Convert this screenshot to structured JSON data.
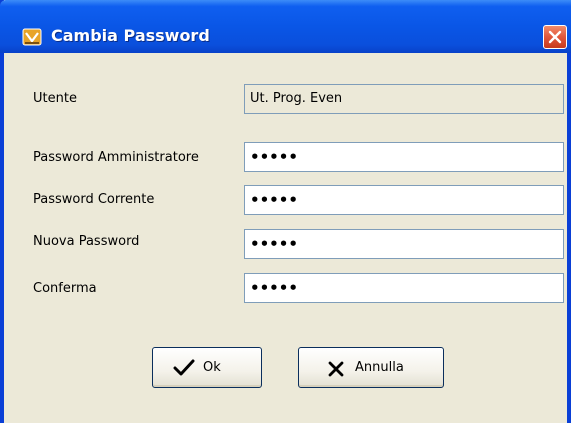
{
  "window": {
    "title": "Cambia Password"
  },
  "form": {
    "user_label": "Utente",
    "user_value": "Ut. Prog. Even",
    "admin_password_label": "Password Amministratore",
    "admin_password_value": "•••••",
    "current_password_label": "Password Corrente",
    "current_password_value": "•••••",
    "new_password_label": "Nuova Password",
    "new_password_value": "•••••",
    "confirm_label": "Conferma",
    "confirm_value": "•••••"
  },
  "buttons": {
    "ok_label": "Ok",
    "cancel_label": "Annulla"
  },
  "colors": {
    "titlebar": "#0a56e6",
    "window_bg": "#ece9d8",
    "close_button": "#e1573c"
  },
  "icons": {
    "title": "shield-key-icon",
    "close": "close-icon",
    "ok": "checkmark-icon",
    "cancel": "x-icon"
  }
}
